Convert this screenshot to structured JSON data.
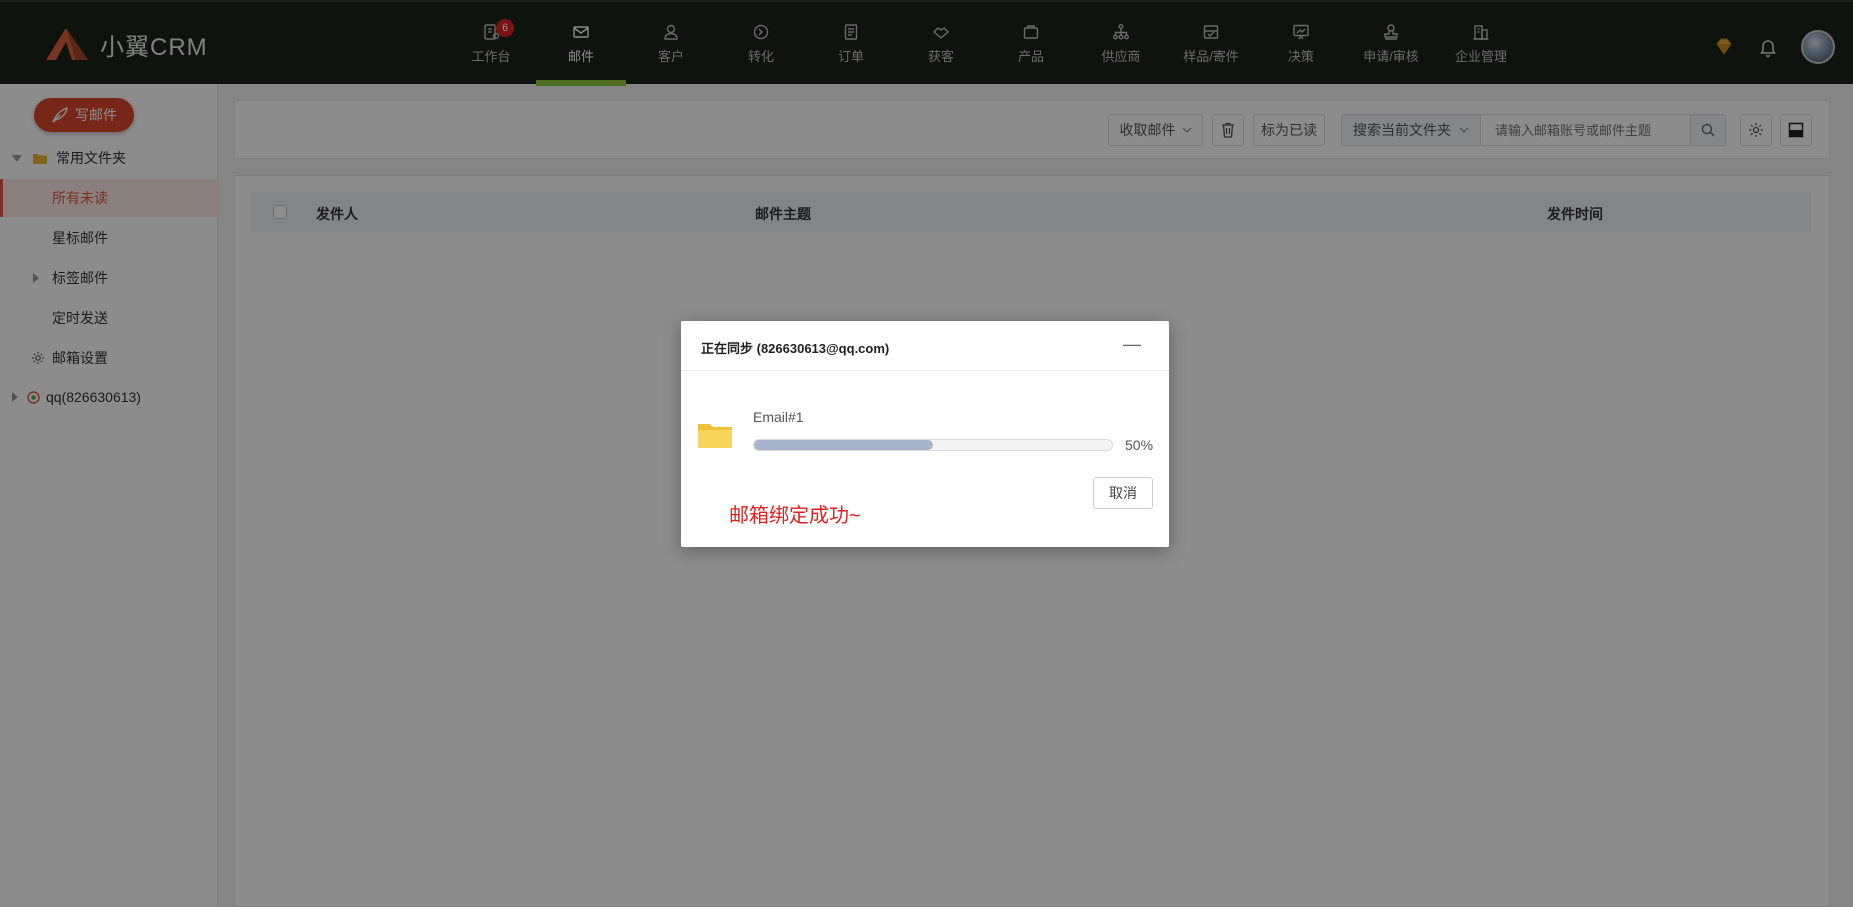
{
  "app": {
    "logo_text": "小翼CRM"
  },
  "nav": {
    "items": [
      {
        "label": "工作台",
        "icon": "workbench-icon",
        "badge": "6"
      },
      {
        "label": "邮件",
        "icon": "mail-icon",
        "active": true
      },
      {
        "label": "客户",
        "icon": "customer-icon"
      },
      {
        "label": "转化",
        "icon": "conversion-icon"
      },
      {
        "label": "订单",
        "icon": "order-icon"
      },
      {
        "label": "获客",
        "icon": "acquisition-icon"
      },
      {
        "label": "产品",
        "icon": "product-icon"
      },
      {
        "label": "供应商",
        "icon": "supplier-icon"
      },
      {
        "label": "样品/寄件",
        "icon": "sample-icon"
      },
      {
        "label": "决策",
        "icon": "decision-icon"
      },
      {
        "label": "申请/审核",
        "icon": "approval-icon"
      },
      {
        "label": "企业管理",
        "icon": "enterprise-icon"
      }
    ]
  },
  "sidebar": {
    "compose_label": "写邮件",
    "common_folder": "常用文件夹",
    "all_unread": "所有未读",
    "starred": "星标邮件",
    "tagged": "标签邮件",
    "scheduled": "定时发送",
    "settings": "邮箱设置",
    "account": "qq(826630613)"
  },
  "toolbar": {
    "fetch_label": "收取邮件",
    "mark_read_label": "标为已读",
    "search_scope": "搜索当前文件夹",
    "search_placeholder": "请输入邮箱账号或邮件主题"
  },
  "list": {
    "columns": {
      "sender": "发件人",
      "subject": "邮件主题",
      "time": "发件时间"
    }
  },
  "dialog": {
    "title": "正在同步 (826630613@qq.com)",
    "minimize": "—",
    "task_name": "Email#1",
    "progress_percent": 50,
    "progress_label": "50%",
    "cancel_label": "取消",
    "success_message": "邮箱绑定成功~"
  },
  "colors": {
    "accent": "#d9452c",
    "nav_active": "#8cc63f",
    "topbar": "#1c2418",
    "progress": "#a9b4cc",
    "success": "#e02020"
  }
}
